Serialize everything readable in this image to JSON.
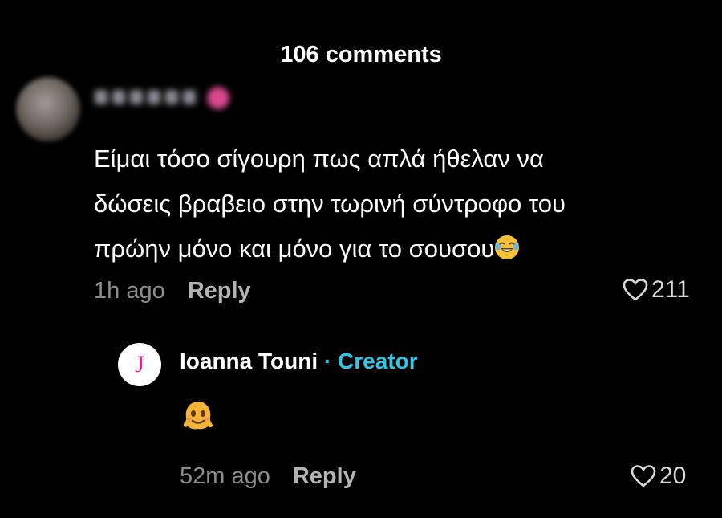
{
  "header": {
    "title": "106 comments"
  },
  "comment": {
    "text_line1": "Είμαι τόσο σίγουρη πως απλά ήθελαν να",
    "text_line2": "δώσεις βραβειο στην τωρινή σύντροφο του",
    "text_line3": "πρώην μόνο και μόνο για το σουσου",
    "text_emoji": "face-with-tears-of-joy",
    "time": "1h ago",
    "reply_label": "Reply",
    "likes": "211"
  },
  "reply": {
    "avatar_letter": "J",
    "author": "Ioanna Touni",
    "separator": "·",
    "creator_badge": "Creator",
    "content_emoji": "melting-face",
    "time": "52m ago",
    "reply_label": "Reply",
    "likes": "20"
  },
  "colors": {
    "background": "#000000",
    "creator_accent": "#2fc7e6",
    "avatar_letter": "#e0208a",
    "muted_text": "#8c8c8c"
  }
}
